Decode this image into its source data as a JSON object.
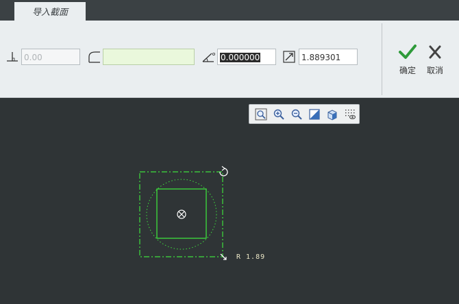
{
  "tab": {
    "label": "导入截面"
  },
  "toolbar": {
    "offset_value": "0.00",
    "curve_value": "",
    "angle_value": "0.000000",
    "scale_value": "1.889301"
  },
  "actions": {
    "ok_label": "确定",
    "cancel_label": "取消"
  },
  "canvas": {
    "radius_label": "R 1.89"
  },
  "colors": {
    "sketch_green": "#3ee03e",
    "check_green": "#2e9a3a",
    "background": "#2f3436"
  },
  "icons": [
    "perpendicular-icon",
    "curve-corner-icon",
    "angle-icon",
    "scale-icon",
    "zoom-fit-icon",
    "zoom-in-icon",
    "zoom-out-icon",
    "shading-icon",
    "box-view-icon",
    "display-style-icon",
    "checkmark-icon",
    "x-icon"
  ]
}
